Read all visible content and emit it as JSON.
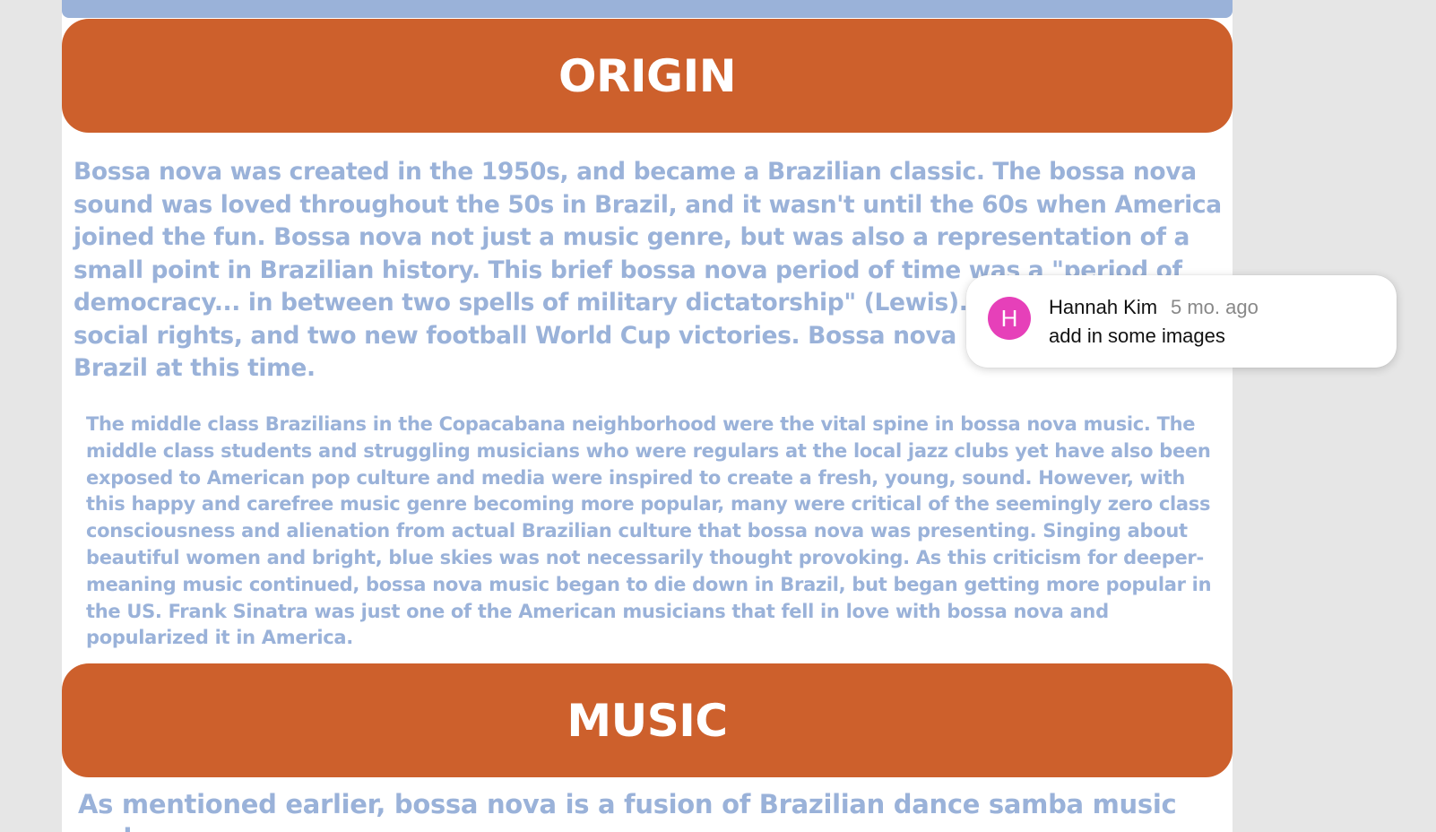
{
  "origin": {
    "title": "ORIGIN",
    "paragraph1": "Bossa nova was created in the 1950s, and became a Brazilian classic. The bossa nova sound was loved throughout the 50s in Brazil, and it wasn't until the 60s when America joined the fun. Bossa nova not just a music genre, but was also a representation of a small point in Brazilian history. This brief bossa nova period of time was a \"period of democracy... in between two spells of military dictatorship\" (Lewis). It brought new social rights, and two new football World Cup victories. Bossa nova became the pride of Brazil at this time.",
    "paragraph2": "The middle class Brazilians in the Copacabana neighborhood were the vital spine in bossa nova music. The middle class students and struggling musicians who were regulars at the local jazz clubs yet have also been exposed to American pop culture and media were inspired to create a fresh, young, sound. However, with this happy and carefree music genre becoming more popular, many were critical of the seemingly zero class consciousness and alienation from actual Brazilian culture that bossa nova was presenting. Singing about beautiful women and bright, blue skies was not necessarily thought provoking. As this criticism for deeper-meaning music continued, bossa nova music began to die down in Brazil, but began getting more popular in the US. Frank Sinatra was just one of the American musicians that fell in love with bossa nova and popularized it in America."
  },
  "music": {
    "title": "MUSIC",
    "paragraph1": "As mentioned earlier, bossa nova is a fusion of Brazilian dance samba music and"
  },
  "comment": {
    "avatar_initial": "H",
    "author": "Hannah Kim",
    "time": "5 mo. ago",
    "text": "add in some images"
  },
  "colors": {
    "header_bg": "#cd602c",
    "body_text": "#9ab2d9",
    "avatar_bg": "#e640b9"
  }
}
